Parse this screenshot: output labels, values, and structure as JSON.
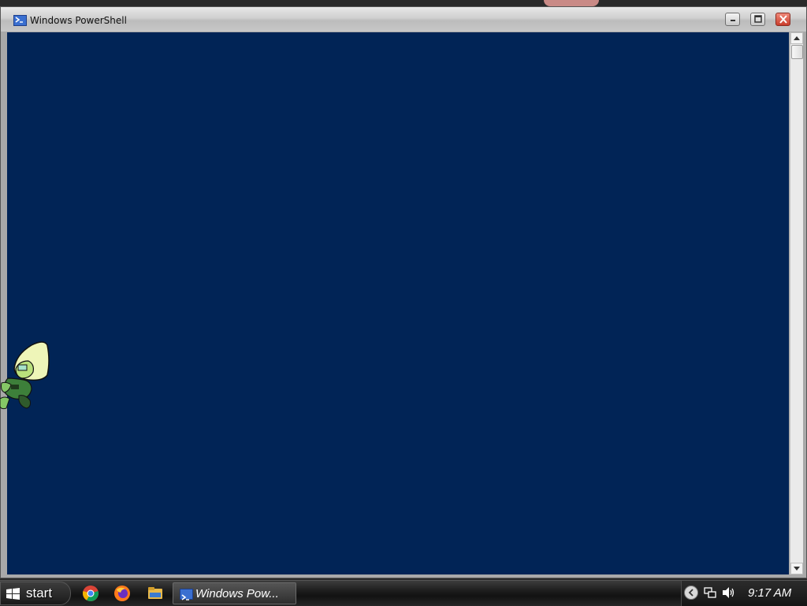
{
  "window": {
    "title": "Windows PowerShell",
    "console_background": "#012456",
    "controls": [
      "minimize",
      "maximize",
      "close"
    ]
  },
  "console": {
    "text": ""
  },
  "taskbar": {
    "start_label": "start",
    "quick_launch": [
      "chrome-icon",
      "firefox-icon",
      "file-explorer-icon"
    ],
    "task_button_label": "Windows Pow...",
    "clock": "9:17 AM"
  },
  "colors": {
    "accent": "#3a6fd0",
    "close_button": "#d9483a"
  }
}
